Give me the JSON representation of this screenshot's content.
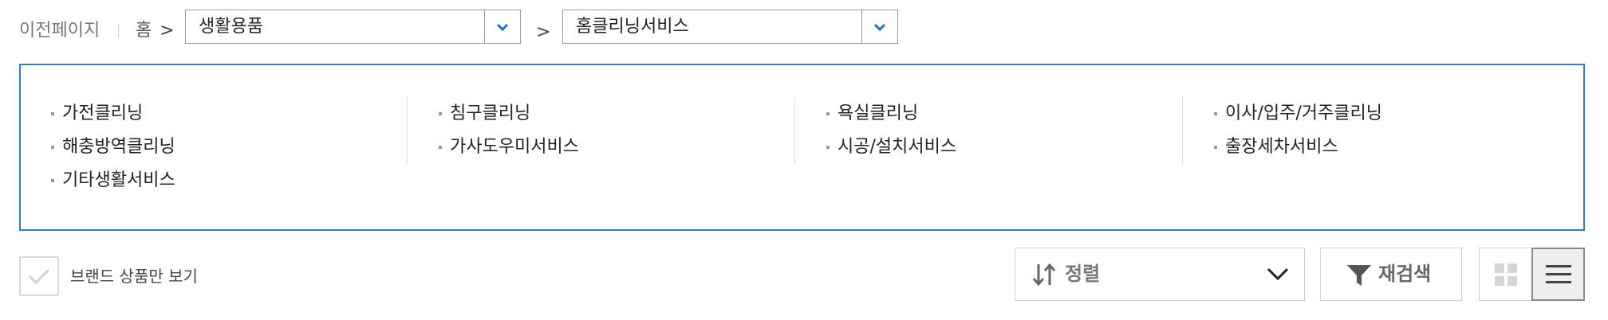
{
  "breadcrumb": {
    "back_label": "이전페이지",
    "home_label": "홈",
    "separator": ">",
    "level1_selected": "생활용품",
    "level2_selected": "홈클리닝서비스"
  },
  "categories": {
    "col1": [
      "가전클리닝",
      "해충방역클리닝",
      "기타생활서비스"
    ],
    "col2": [
      "침구클리닝",
      "가사도우미서비스"
    ],
    "col3": [
      "욕실클리닝",
      "시공/설치서비스"
    ],
    "col4": [
      "이사/입주/거주클리닝",
      "출장세차서비스"
    ]
  },
  "filters": {
    "brand_only_label": "브랜드 상품만 보기",
    "sort_label": "정렬",
    "research_label": "재검색"
  },
  "icons": {
    "dropdown": "chevron-down-icon",
    "check": "check-icon",
    "sort": "sort-arrows-icon",
    "filter": "filter-icon",
    "grid": "grid-view-icon",
    "list": "list-view-icon"
  },
  "colors": {
    "accent_blue": "#2d7fd6",
    "border_gray": "#d0d0d0"
  }
}
